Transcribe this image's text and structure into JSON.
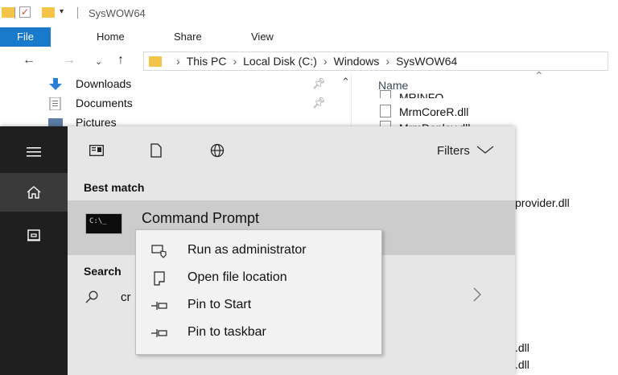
{
  "window": {
    "title": "SysWOW64"
  },
  "ribbon": {
    "tabs": [
      "File",
      "Home",
      "Share",
      "View"
    ]
  },
  "address": {
    "crumbs": [
      "This PC",
      "Local Disk (C:)",
      "Windows",
      "SysWOW64"
    ]
  },
  "nav_pane": {
    "items": [
      {
        "label": "Downloads",
        "icon": "download-arrow-icon"
      },
      {
        "label": "Documents",
        "icon": "documents-icon"
      },
      {
        "label": "Pictures",
        "icon": "pictures-icon"
      }
    ]
  },
  "file_list": {
    "column_name": "Name",
    "rows": [
      "MRINFO",
      "MrmCoreR.dll",
      "MrmDeploy.dll"
    ],
    "right_fragments": [
      "provider.dll",
      ".dll",
      ".dll"
    ]
  },
  "start": {
    "filters_label": "Filters",
    "best_match_label": "Best match",
    "best_match_title": "Command Prompt",
    "search_label": "Search",
    "search_query": "cr",
    "cmd_icon_text": "C:\\_"
  },
  "context_menu": {
    "items": [
      {
        "label": "Run as administrator",
        "icon": "shield-run-icon"
      },
      {
        "label": "Open file location",
        "icon": "open-location-icon"
      },
      {
        "label": "Pin to Start",
        "icon": "pin-icon"
      },
      {
        "label": "Pin to taskbar",
        "icon": "pin-icon"
      }
    ]
  },
  "colors": {
    "accent": "#1979ca",
    "folder": "#f3c448",
    "rail": "#1f1f1f",
    "panel": "#e6e6e6",
    "highlight": "#cccccc"
  }
}
